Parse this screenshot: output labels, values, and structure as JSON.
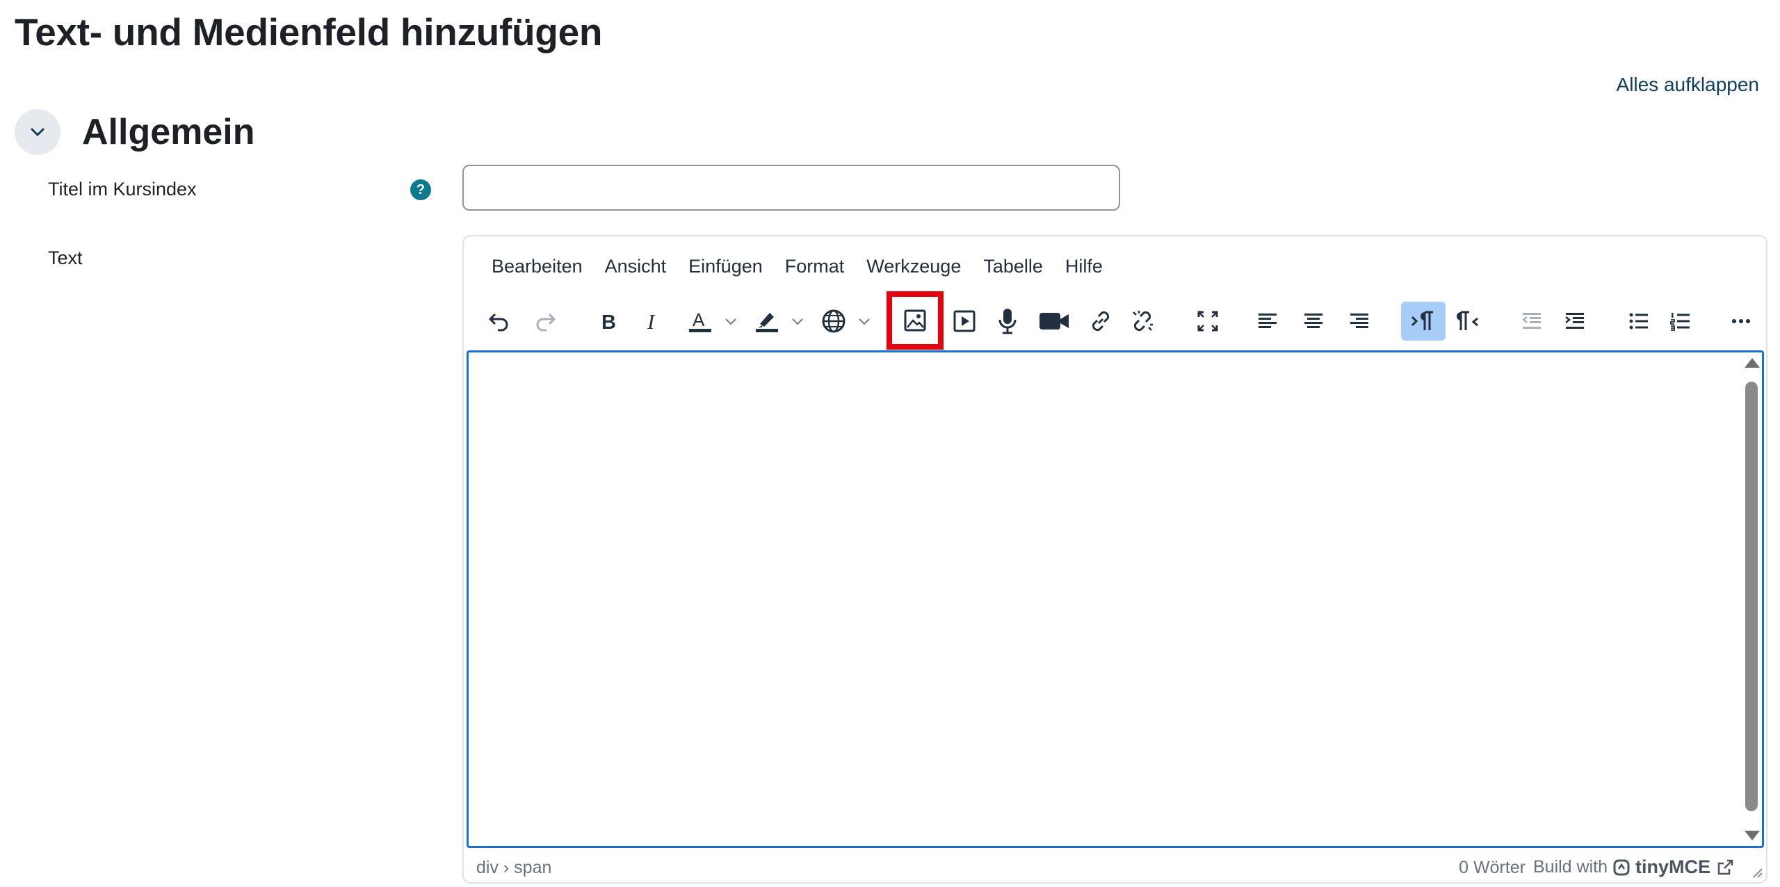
{
  "page": {
    "title": "Text- und Medienfeld hinzufügen",
    "expand_all": "Alles aufklappen"
  },
  "section": {
    "title": "Allgemein"
  },
  "fields": {
    "title_label": "Titel im Kursindex",
    "title_value": "",
    "help_glyph": "?",
    "text_label": "Text"
  },
  "editor": {
    "menu": [
      "Bearbeiten",
      "Ansicht",
      "Einfügen",
      "Format",
      "Werkzeuge",
      "Tabelle",
      "Hilfe"
    ],
    "toolbar_icons": [
      "undo-icon",
      "redo-icon",
      "bold-icon",
      "italic-icon",
      "text-color-icon",
      "highlight-color-icon",
      "language-icon",
      "image-icon",
      "media-icon",
      "record-audio-icon",
      "record-video-icon",
      "link-icon",
      "unlink-icon",
      "fullscreen-icon",
      "align-left-icon",
      "align-center-icon",
      "align-right-icon",
      "ltr-icon",
      "rtl-icon",
      "outdent-icon",
      "indent-icon",
      "bullet-list-icon",
      "numbered-list-icon",
      "more-icon"
    ],
    "active_button": "ltr-icon",
    "highlighted_button": "image-icon",
    "highlight_color": "#e3000f",
    "status_path": "div › span",
    "word_count": "0 Wörter",
    "build_with": "Build with",
    "brand": "tinyMCE"
  }
}
